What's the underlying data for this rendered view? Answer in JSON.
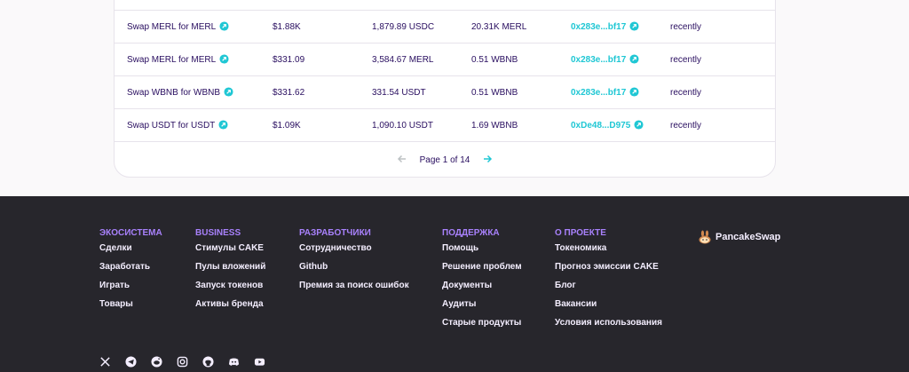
{
  "transactions": [
    {
      "action": "Swap MERL for MERL",
      "value": "$1.88K",
      "token1": "1,879.89 USDC",
      "token2": "20.31K MERL",
      "account": "0x283e...bf17",
      "time": "recently"
    },
    {
      "action": "Swap MERL for MERL",
      "value": "$331.09",
      "token1": "3,584.67 MERL",
      "token2": "0.51 WBNB",
      "account": "0x283e...bf17",
      "time": "recently"
    },
    {
      "action": "Swap WBNB for WBNB",
      "value": "$331.62",
      "token1": "331.54 USDT",
      "token2": "0.51 WBNB",
      "account": "0x283e...bf17",
      "time": "recently"
    },
    {
      "action": "Swap USDT for USDT",
      "value": "$1.09K",
      "token1": "1,090.10 USDT",
      "token2": "1.69 WBNB",
      "account": "0xDe48...D975",
      "time": "recently"
    }
  ],
  "pagination": {
    "label": "Page 1 of 14"
  },
  "footer": {
    "ecosystem": {
      "title": "ЭКОСИСТЕМА",
      "items": [
        "Сделки",
        "Заработать",
        "Играть",
        "Товары"
      ]
    },
    "business": {
      "title": "BUSINESS",
      "items": [
        "Стимулы CAKE",
        "Пулы вложений",
        "Запуск токенов",
        "Активы бренда"
      ]
    },
    "developers": {
      "title": "РАЗРАБОТЧИКИ",
      "items": [
        "Сотрудничество",
        "Github",
        "Премия за поиск ошибок"
      ]
    },
    "support": {
      "title": "ПОДДЕРЖКА",
      "items": [
        "Помощь",
        "Решение проблем",
        "Документы",
        "Аудиты",
        "Старые продукты"
      ]
    },
    "about": {
      "title": "О ПРОЕКТЕ",
      "items": [
        "Токеномика",
        "Прогноз эмиссии CAKE",
        "Блог",
        "Вакансии",
        "Условия использования"
      ]
    },
    "logo_text": "PancakeSwap"
  },
  "socials": [
    "x-icon",
    "telegram-icon",
    "reddit-icon",
    "instagram-icon",
    "github-icon",
    "discord-icon",
    "youtube-icon"
  ],
  "colors": {
    "accent": "#1fc7d4",
    "text": "#280d5f",
    "footer_bg": "#27262c",
    "footer_head": "#a881fc"
  }
}
